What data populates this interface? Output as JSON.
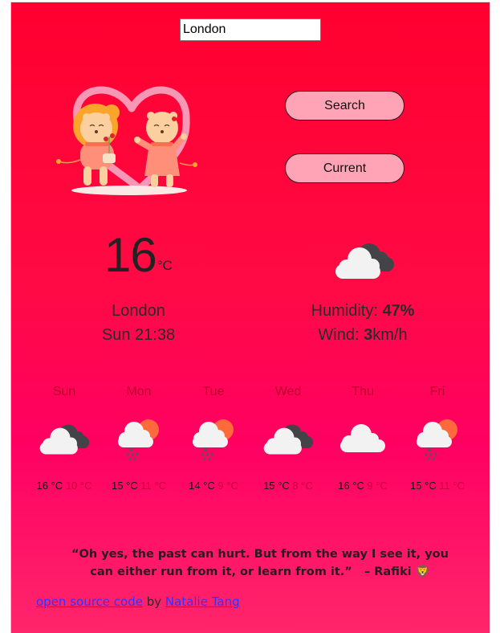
{
  "search": {
    "value": "London",
    "placeholder": ""
  },
  "buttons": {
    "search_label": "Search",
    "current_label": "Current"
  },
  "illustration": {
    "name": "lion-couple-heart-illustration"
  },
  "current": {
    "temperature": "16",
    "unit": "°C",
    "city": "London",
    "datetime": "Sun 21:38",
    "icon": "cloudy-dark-cloud-icon",
    "humidity_label": "Humidity: ",
    "humidity_value": "47%",
    "wind_label": "Wind: ",
    "wind_value": "3",
    "wind_unit": "km/h"
  },
  "forecast": [
    {
      "day": "Sun",
      "icon": "broken-clouds-icon",
      "high": "16 °C",
      "low": "10 °C"
    },
    {
      "day": "Mon",
      "icon": "sun-rain-cloud-icon",
      "high": "15 °C",
      "low": "11 °C"
    },
    {
      "day": "Tue",
      "icon": "sun-rain-cloud-icon",
      "high": "14 °C",
      "low": "9 °C"
    },
    {
      "day": "Wed",
      "icon": "broken-clouds-icon",
      "high": "15 °C",
      "low": "8 °C"
    },
    {
      "day": "Thu",
      "icon": "cloud-icon",
      "high": "16 °C",
      "low": "9 °C"
    },
    {
      "day": "Fri",
      "icon": "sun-rain-cloud-icon",
      "high": "15 °C",
      "low": "11 °C"
    }
  ],
  "quote": {
    "text": "“Oh yes, the past can hurt. But from the way I see it, you can either run from it, or learn from it.”",
    "author": "– Rafiki",
    "emoji": "🦁"
  },
  "footer": {
    "source_link": "open source code",
    "by": " by ",
    "author_link": "Natalie Tang"
  },
  "colors": {
    "background_top": "#ff0030",
    "background_bottom": "#ff266b",
    "button_fill": "#ffa4b7",
    "link": "#3333ff",
    "sun": "#ff6a3d",
    "cloud_light": "#f2f2f2",
    "cloud_dark": "#444448"
  }
}
